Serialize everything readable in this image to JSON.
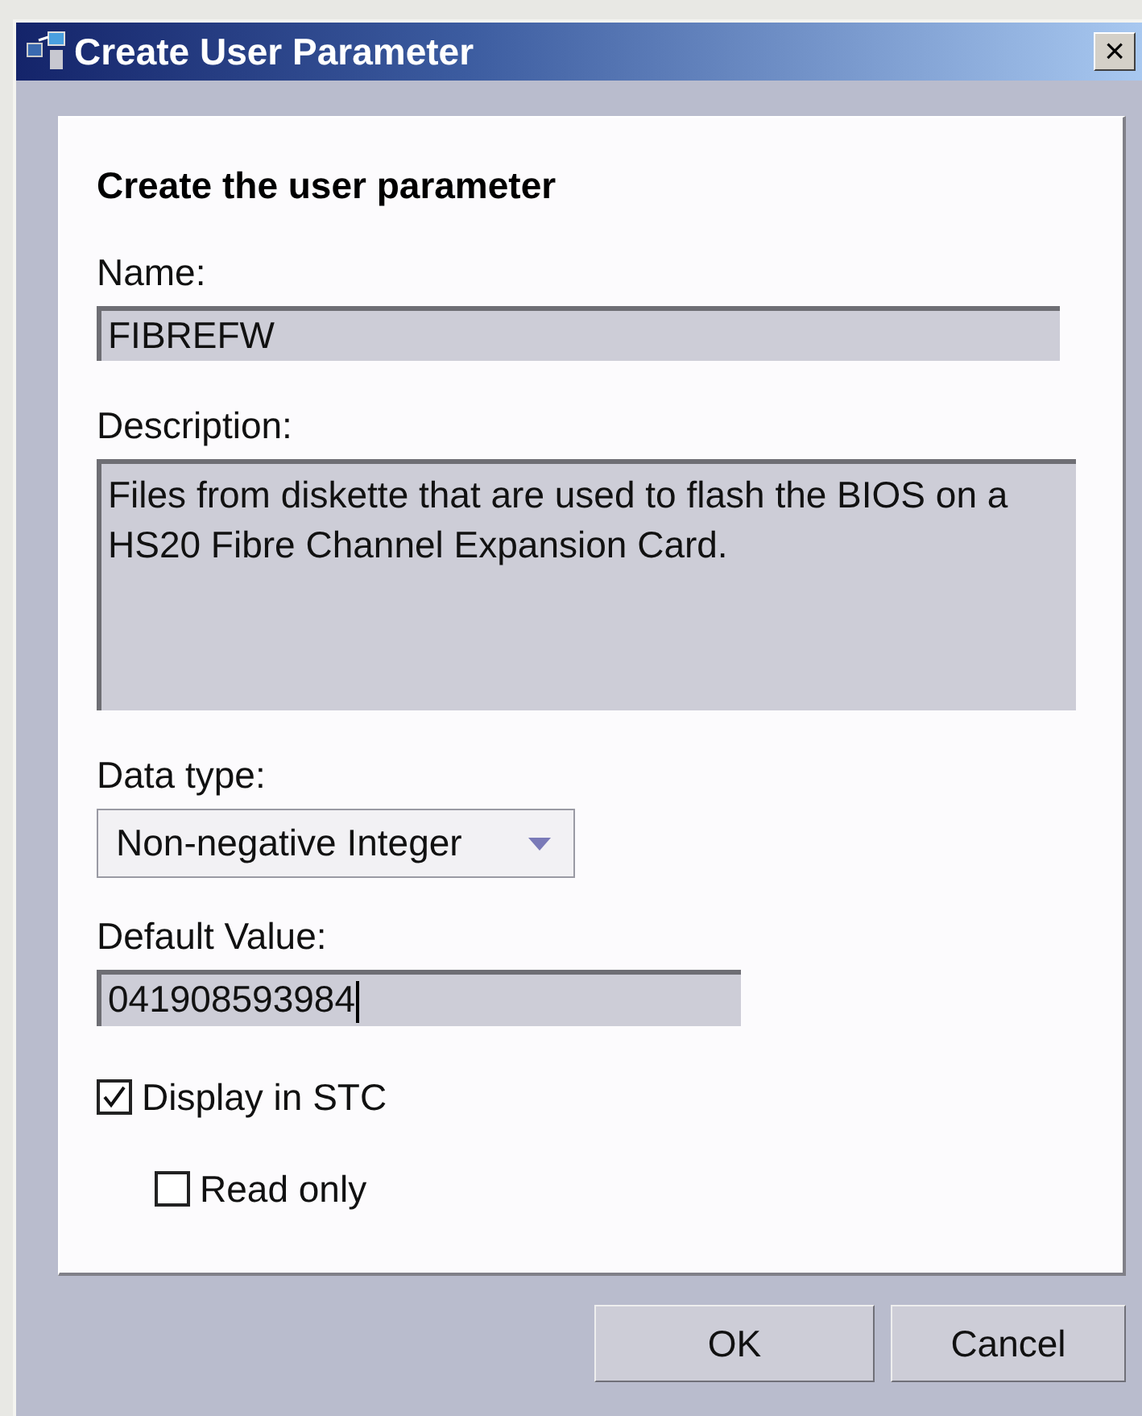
{
  "window": {
    "title": "Create User Parameter",
    "close": "×"
  },
  "heading": "Create the user parameter",
  "name": {
    "label": "Name:",
    "value": "FIBREFW"
  },
  "description": {
    "label": "Description:",
    "value": "Files from diskette that are used to flash the BIOS on a HS20 Fibre Channel Expansion Card."
  },
  "data_type": {
    "label": "Data type:",
    "value": "Non-negative Integer"
  },
  "default_value": {
    "label": "Default Value:",
    "value": "041908593984"
  },
  "checkboxes": [
    {
      "label": "Display in STC",
      "checked": true,
      "indented": false
    },
    {
      "label": "Read only",
      "checked": false,
      "indented": true
    }
  ],
  "buttons": [
    "OK",
    "Cancel"
  ]
}
